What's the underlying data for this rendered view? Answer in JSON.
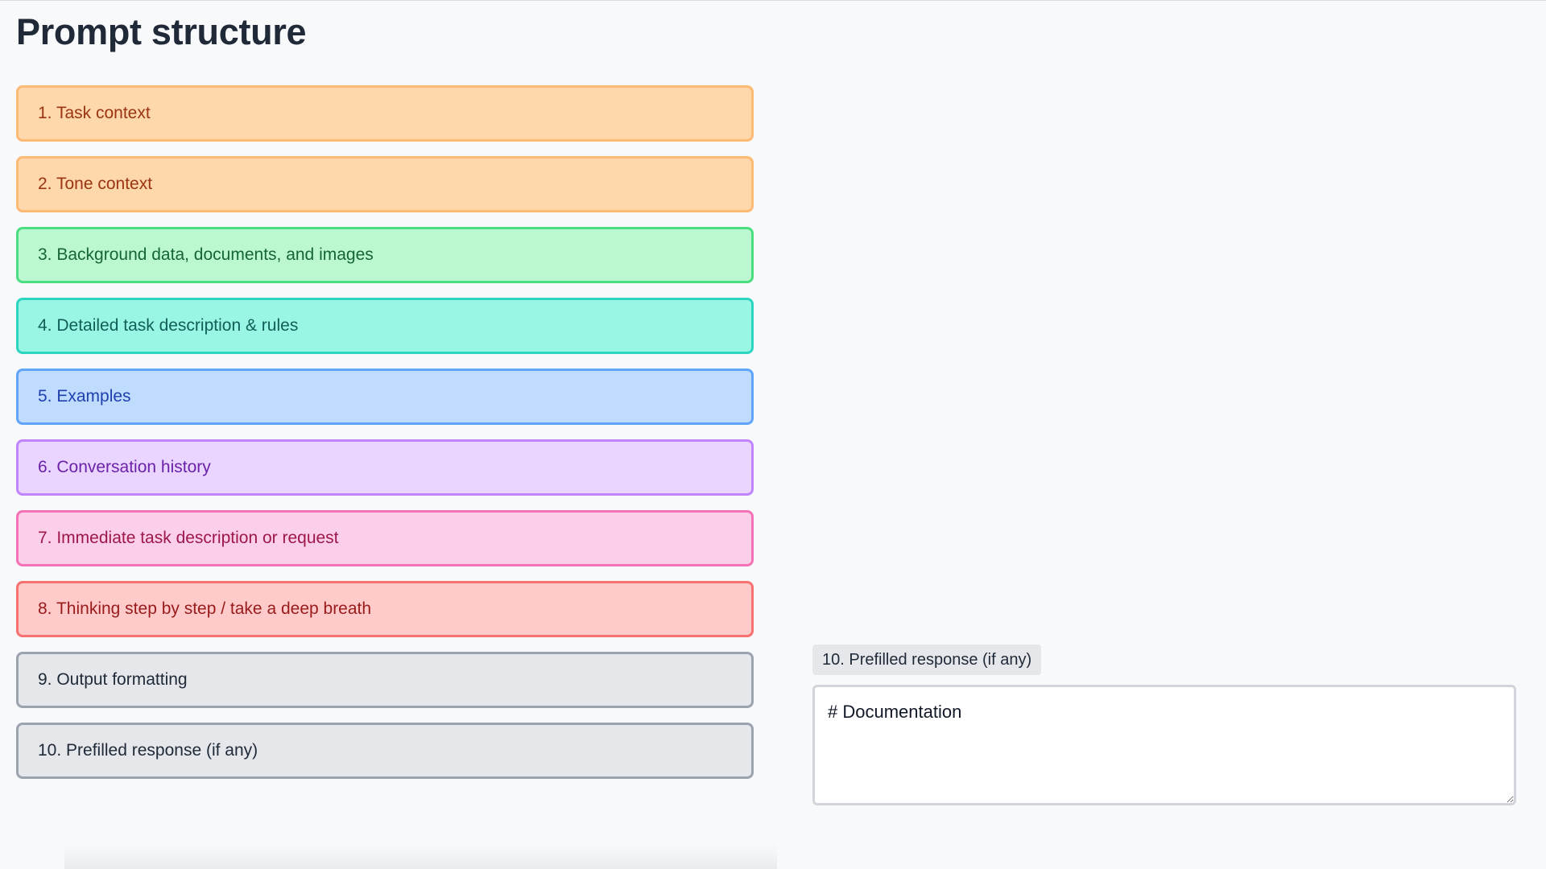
{
  "page": {
    "title": "Prompt structure"
  },
  "sections": [
    {
      "label": "1. Task context",
      "color": "#fed7aa"
    },
    {
      "label": "2. Tone context",
      "color": "#fed7aa"
    },
    {
      "label": "3. Background data, documents, and images",
      "color": "#bbf7d0"
    },
    {
      "label": "4. Detailed task description & rules",
      "color": "#99f6e4"
    },
    {
      "label": "5. Examples",
      "color": "#bfdbfe"
    },
    {
      "label": "6. Conversation history",
      "color": "#e9d5ff"
    },
    {
      "label": "7. Immediate task description or request",
      "color": "#fbcfe8"
    },
    {
      "label": "8. Thinking step by step / take a deep breath",
      "color": "#fecaca"
    },
    {
      "label": "9. Output formatting",
      "color": "#e5e7eb"
    },
    {
      "label": "10. Prefilled response (if any)",
      "color": "#e5e7eb"
    }
  ],
  "detail": {
    "label": "10. Prefilled response (if any)",
    "value": "# Documentation"
  }
}
